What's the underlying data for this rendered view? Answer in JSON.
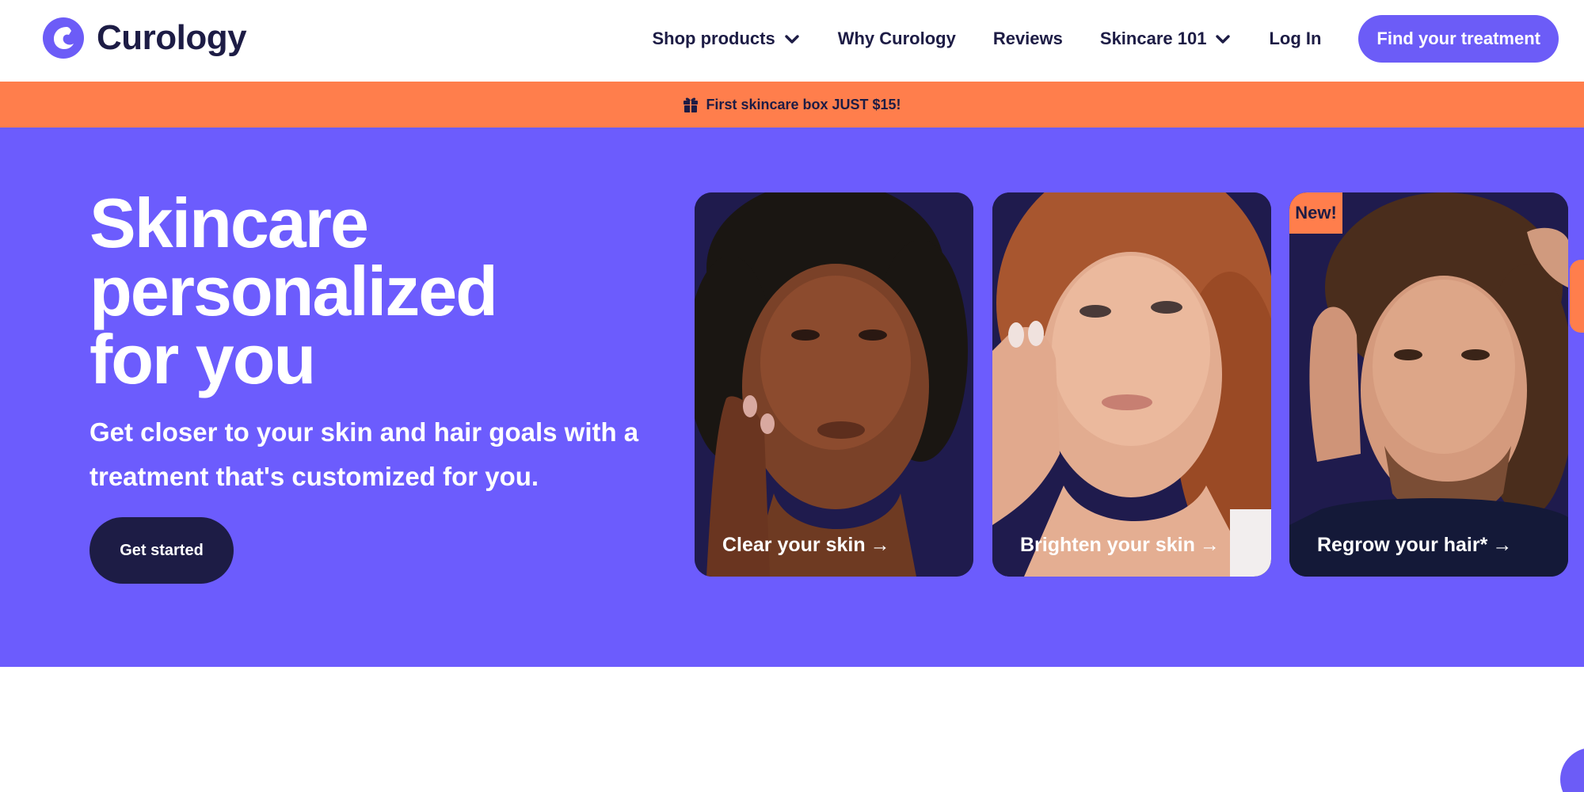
{
  "brand": {
    "name": "Curology",
    "accent": "#6c5cf7",
    "navy": "#1d1c45",
    "promo_color": "#ff7e4c"
  },
  "nav": {
    "items": [
      {
        "label": "Shop products",
        "dropdown": true
      },
      {
        "label": "Why Curology",
        "dropdown": false
      },
      {
        "label": "Reviews",
        "dropdown": false
      },
      {
        "label": "Skincare 101",
        "dropdown": true
      },
      {
        "label": "Log In",
        "dropdown": false
      }
    ],
    "cta": "Find your treatment"
  },
  "promo": {
    "icon": "gift-icon",
    "text": "First skincare box JUST $15!"
  },
  "hero": {
    "title_lines": [
      "Skincare",
      "personalized",
      "for you"
    ],
    "subtitle": "Get closer to your skin and hair goals with a treatment that's customized for you.",
    "button": "Get started",
    "cards": [
      {
        "label": "Clear your skin",
        "arrow": "→"
      },
      {
        "label": "Brighten your skin",
        "arrow": "→"
      },
      {
        "label": "Regrow your hair*",
        "arrow": "→",
        "badge": "New!"
      }
    ]
  }
}
